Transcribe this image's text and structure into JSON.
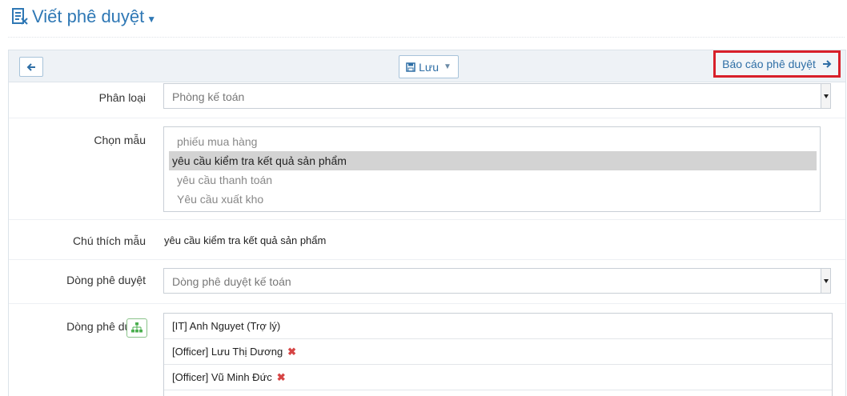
{
  "header": {
    "title": "Viết phê duyệt"
  },
  "toolbar": {
    "save_label": "Lưu",
    "report_label": "Báo cáo phê duyệt"
  },
  "form": {
    "category": {
      "label": "Phân loại",
      "value": "Phòng kế toán"
    },
    "template": {
      "label": "Chọn mẫu",
      "options": [
        "phiếu mua hàng",
        "yêu cầu kiểm tra kết quả sản phẩm",
        "yêu cầu thanh toán",
        "Yêu cầu xuất kho"
      ],
      "selected_index": 1
    },
    "template_note": {
      "label": "Chú thích mẫu",
      "value": "yêu cầu kiểm tra kết quả sản phẩm"
    },
    "approval_line_select": {
      "label": "Dòng phê duyệt",
      "value": "Dòng phê duyệt kế toán"
    },
    "approval_line": {
      "label": "Dòng phê duyệt",
      "items": [
        {
          "text": "[IT] Anh Nguyet (Trợ lý)",
          "removable": false
        },
        {
          "text": "[Officer] Lưu Thị Dương",
          "removable": true
        },
        {
          "text": "[Officer] Vũ Minh Đức",
          "removable": true
        }
      ]
    }
  },
  "colors": {
    "accent": "#2f78b5",
    "highlight_border": "#d8202a",
    "remove": "#d64545",
    "selected_option": "#d3d3d3"
  }
}
